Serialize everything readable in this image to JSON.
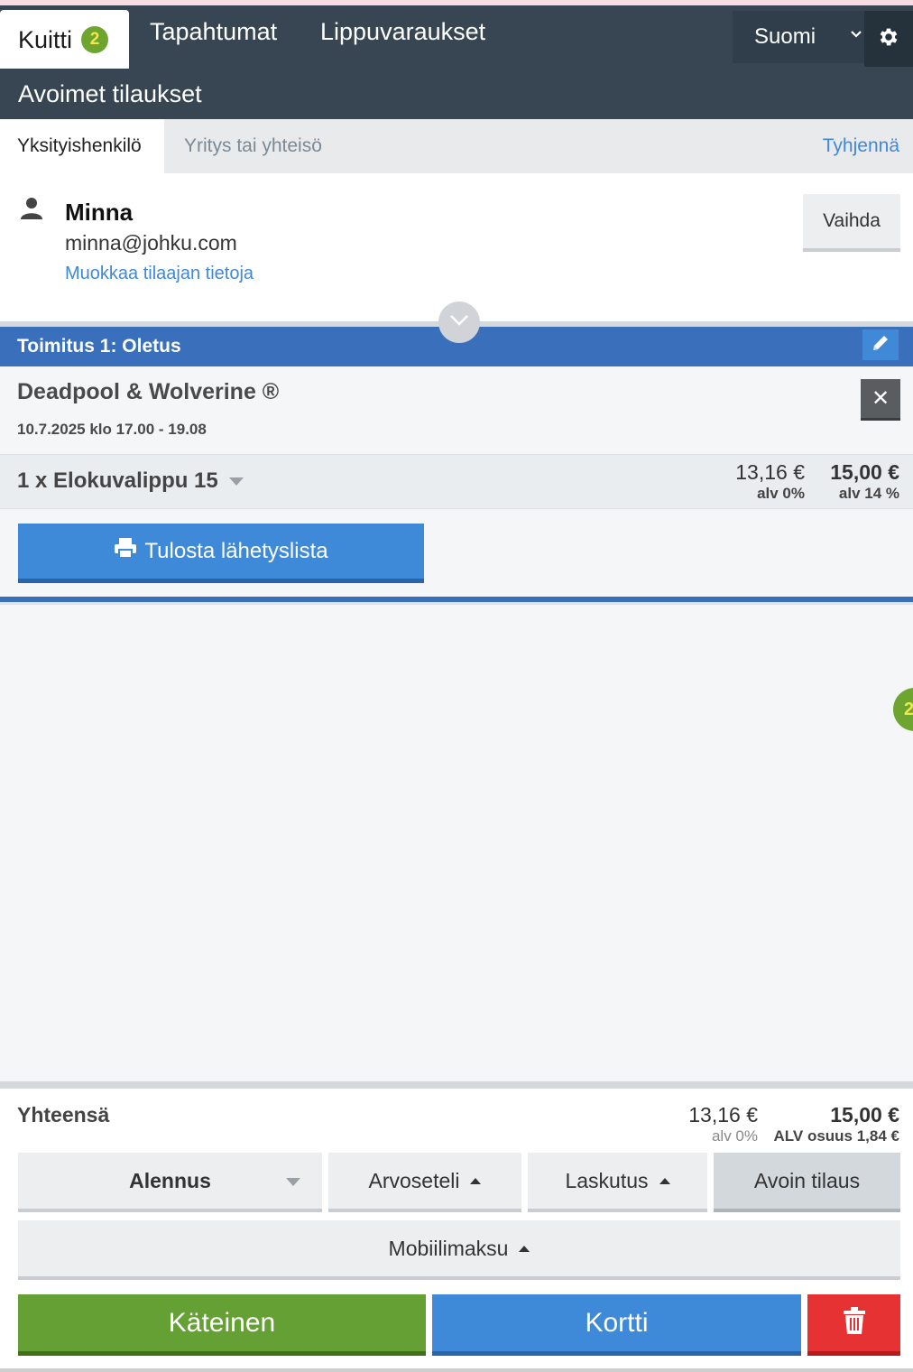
{
  "nav": {
    "active_tab": "Kuitti",
    "active_badge": "2",
    "tabs": [
      "Tapahtumat",
      "Lippuvaraukset"
    ],
    "language": "Suomi"
  },
  "subheader": {
    "title": "Avoimet tilaukset"
  },
  "customer_tabs": {
    "private": "Yksityishenkilö",
    "company": "Yritys tai yhteisö",
    "clear": "Tyhjennä"
  },
  "customer": {
    "name": "Minna",
    "email": "minna@johku.com",
    "edit_link": "Muokkaa tilaajan tietoja",
    "change_button": "Vaihda"
  },
  "delivery": {
    "title": "Toimitus 1: Oletus"
  },
  "event": {
    "title": "Deadpool & Wolverine ®",
    "datetime": "10.7.2025 klo 17.00 - 19.08"
  },
  "ticket": {
    "label": "1 x Elokuvalippu 15",
    "price_net": "13,16 €",
    "vat_net": "alv 0%",
    "price_gross": "15,00 €",
    "vat_gross": "alv 14 %"
  },
  "print_button": "Tulosta lähetyslista",
  "side_badge": "2",
  "totals": {
    "label": "Yhteensä",
    "net": "13,16 €",
    "net_vat": "alv 0%",
    "gross": "15,00 €",
    "gross_vat": "ALV osuus 1,84 €"
  },
  "options": {
    "discount": "Alennus",
    "voucher": "Arvoseteli",
    "billing": "Laskutus",
    "open_order": "Avoin tilaus",
    "mobile": "Mobiilimaksu"
  },
  "payment": {
    "cash": "Käteinen",
    "card": "Kortti"
  },
  "colors": {
    "nav_bg": "#374652",
    "accent_blue": "#3f8ad8",
    "delivery_blue": "#3a6fbb",
    "cash_green": "#64a034",
    "delete_red": "#e63232",
    "link": "#3f89d6"
  },
  "icons": [
    "gear-icon",
    "person-icon",
    "chevron-down-icon",
    "pencil-icon",
    "close-icon",
    "printer-icon",
    "trash-icon"
  ]
}
